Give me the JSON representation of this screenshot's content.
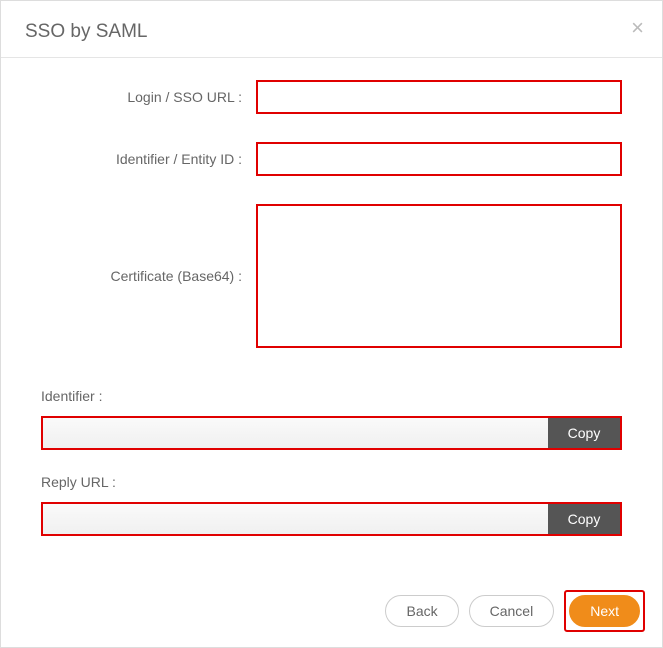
{
  "dialog": {
    "title": "SSO by SAML",
    "close_label": "×"
  },
  "form": {
    "login_url_label": "Login / SSO URL :",
    "login_url_value": "",
    "entity_id_label": "Identifier / Entity ID :",
    "entity_id_value": "",
    "certificate_label": "Certificate (Base64) :",
    "certificate_value": ""
  },
  "output": {
    "identifier_label": "Identifier :",
    "identifier_value": "",
    "reply_url_label": "Reply URL :",
    "reply_url_value": "",
    "copy_label": "Copy"
  },
  "footer": {
    "back_label": "Back",
    "cancel_label": "Cancel",
    "next_label": "Next"
  }
}
